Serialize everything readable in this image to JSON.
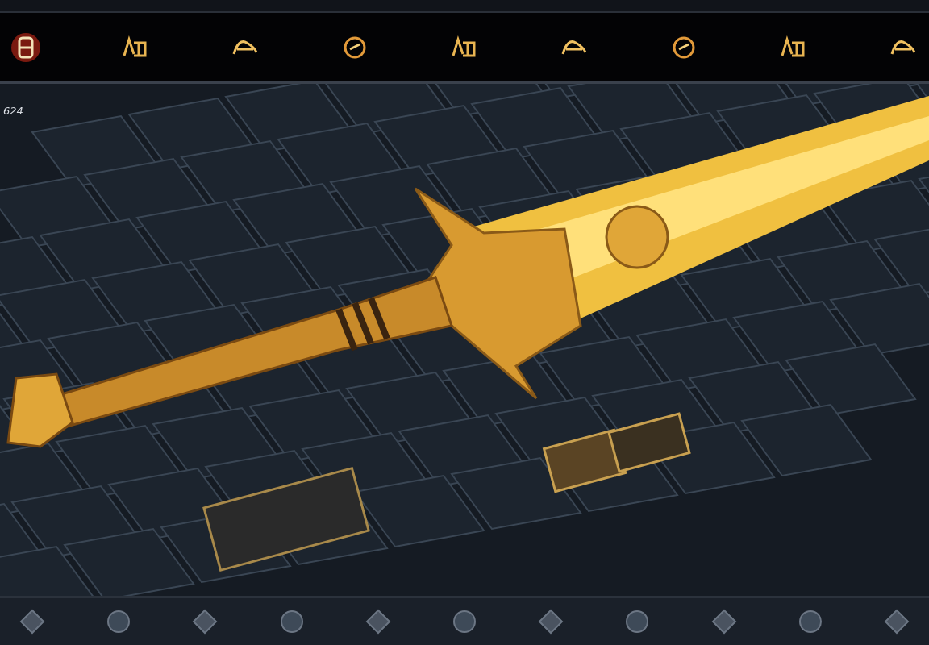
{
  "canvas": {
    "counter": "624"
  }
}
